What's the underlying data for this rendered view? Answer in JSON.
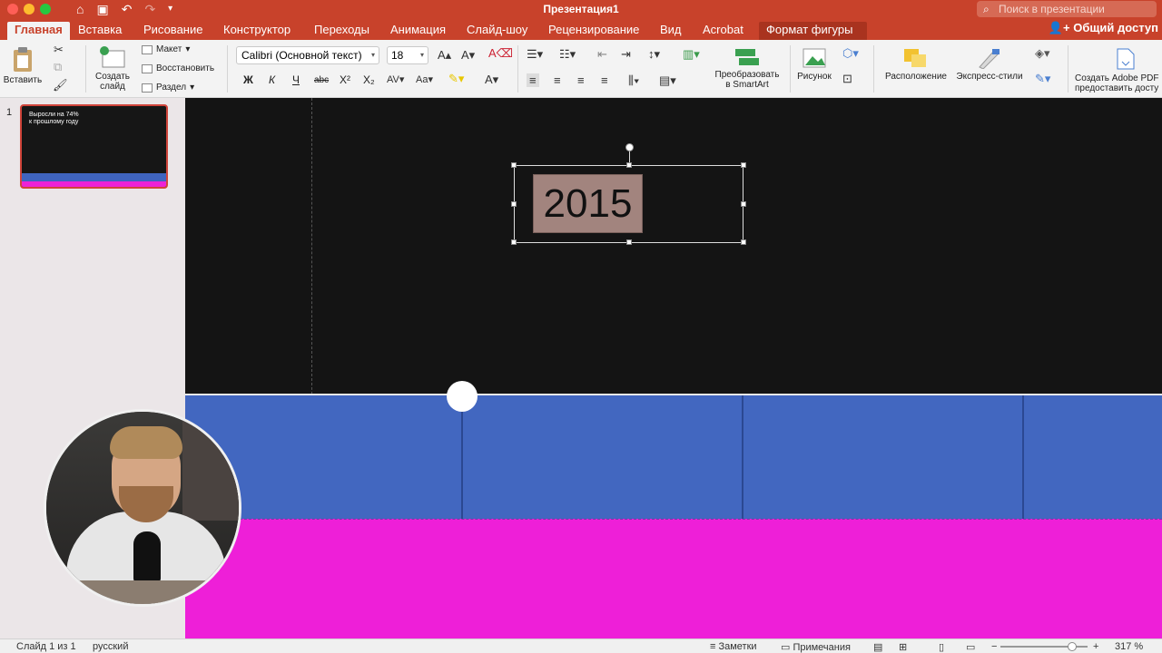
{
  "titlebar": {
    "title": "Презентация1",
    "search_placeholder": "Поиск в презентации",
    "share_label": "Общий доступ"
  },
  "tabs": [
    {
      "label": "Главная"
    },
    {
      "label": "Вставка"
    },
    {
      "label": "Рисование"
    },
    {
      "label": "Конструктор"
    },
    {
      "label": "Переходы"
    },
    {
      "label": "Анимация"
    },
    {
      "label": "Слайд-шоу"
    },
    {
      "label": "Рецензирование"
    },
    {
      "label": "Вид"
    },
    {
      "label": "Acrobat"
    },
    {
      "label": "Формат фигуры"
    }
  ],
  "ribbon": {
    "paste_label": "Вставить",
    "new_slide_label_1": "Создать",
    "new_slide_label_2": "слайд",
    "layout_label": "Макет",
    "reset_label": "Восстановить",
    "section_label": "Раздел",
    "font_name": "Calibri (Основной текст)",
    "font_size": "18",
    "bold": "Ж",
    "italic": "К",
    "underline": "Ч",
    "strike": "abc",
    "superscript": "X²",
    "subscript": "X₂",
    "smartart_label_1": "Преобразовать",
    "smartart_label_2": "в SmartArt",
    "picture_label": "Рисунок",
    "arrange_label": "Расположение",
    "quick_styles_label": "Экспресс-стили",
    "pdf_label_1": "Создать Adobe PDF",
    "pdf_label_2": "предоставить досту"
  },
  "slides_panel": {
    "slide_number": "1",
    "thumb_text_1": "Выросли на 74%",
    "thumb_text_2": "к прошлому году"
  },
  "slide": {
    "year_text": "2015"
  },
  "status": {
    "slide_info": "Слайд 1 из 1",
    "language": "русский",
    "notes_label": "Заметки",
    "comments_label": "Примечания",
    "zoom": "317 %"
  },
  "colors": {
    "accent": "#c8422b",
    "blue_band": "#4267c0",
    "pink_band": "#ee1fd8",
    "slide_bg": "#141414",
    "year_fill": "#a2847e"
  }
}
